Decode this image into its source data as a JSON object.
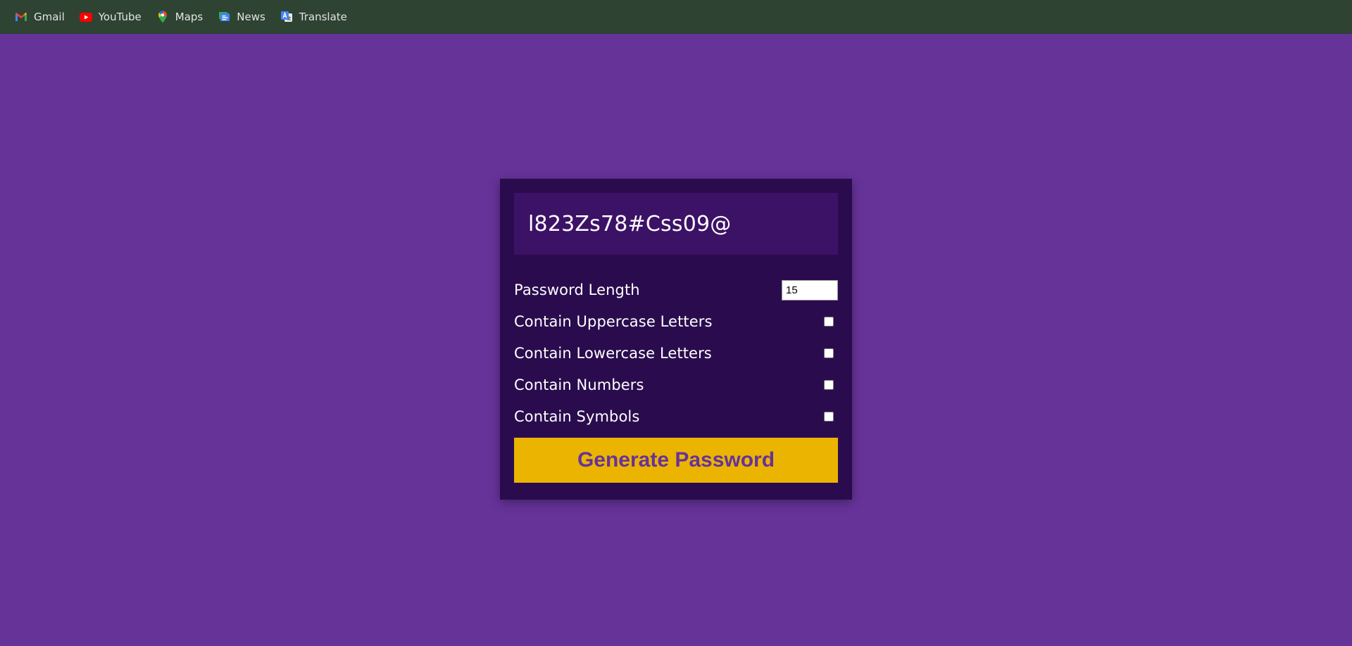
{
  "bookmarks": [
    {
      "label": "Gmail",
      "icon": "gmail-icon"
    },
    {
      "label": "YouTube",
      "icon": "youtube-icon"
    },
    {
      "label": "Maps",
      "icon": "maps-icon"
    },
    {
      "label": "News",
      "icon": "news-icon"
    },
    {
      "label": "Translate",
      "icon": "translate-icon"
    }
  ],
  "generator": {
    "password": "l823Zs78#Css09@",
    "length_label": "Password Length",
    "length_value": "15",
    "options": [
      {
        "label": "Contain Uppercase Letters",
        "checked": false
      },
      {
        "label": "Contain Lowercase Letters",
        "checked": false
      },
      {
        "label": "Contain Numbers",
        "checked": false
      },
      {
        "label": "Contain Symbols",
        "checked": false
      }
    ],
    "button_label": "Generate Password"
  },
  "colors": {
    "page_bg": "#663399",
    "card_bg": "#2a0c4e",
    "result_bg": "#3c1266",
    "button_bg": "#ebb400",
    "button_text": "#663399",
    "bookmarks_bar_bg": "#2e4332"
  }
}
